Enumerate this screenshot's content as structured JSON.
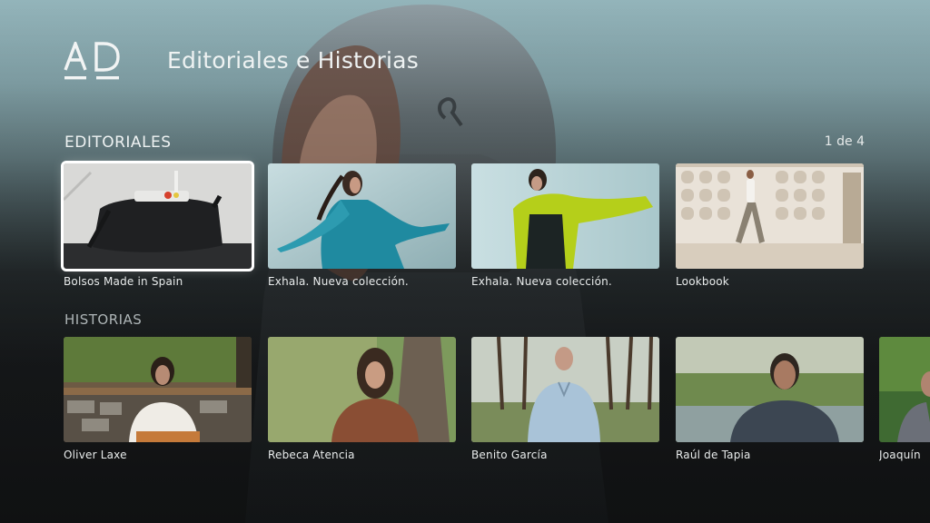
{
  "header": {
    "logo": "AD",
    "title": "Editoriales e Historias"
  },
  "editoriales": {
    "title": "EDITORIALES",
    "pager": "1 de 4",
    "items": [
      {
        "label": "Bolsos Made in Spain",
        "focused": true
      },
      {
        "label": "Exhala. Nueva colección."
      },
      {
        "label": "Exhala. Nueva colección."
      },
      {
        "label": "Lookbook"
      }
    ]
  },
  "historias": {
    "title": "HISTORIAS",
    "items": [
      {
        "label": "Oliver Laxe"
      },
      {
        "label": "Rebeca Atencia"
      },
      {
        "label": "Benito García"
      },
      {
        "label": "Raúl de Tapia"
      },
      {
        "label": "Joaquín"
      }
    ]
  },
  "colors": {
    "background_top": "#93b4ba",
    "background_bottom": "#161718",
    "text": "#eef2f2",
    "focus_border": "#ffffff"
  }
}
